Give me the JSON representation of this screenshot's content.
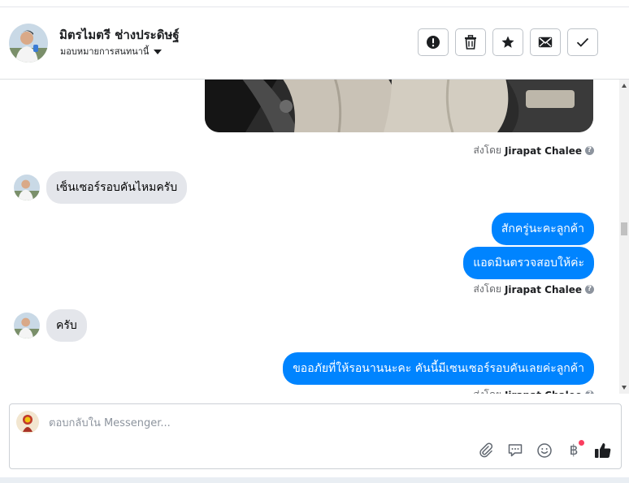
{
  "header": {
    "name": "มิตรไมตรี ช่างประดิษฐ์",
    "assign_label": "มอบหมายการสนทนานี้",
    "actions": [
      {
        "name": "report-button",
        "icon": "exclamation-icon"
      },
      {
        "name": "delete-button",
        "icon": "trash-icon"
      },
      {
        "name": "star-button",
        "icon": "star-icon"
      },
      {
        "name": "mark-unread-button",
        "icon": "envelope-icon"
      },
      {
        "name": "mark-done-button",
        "icon": "checkmark-icon"
      }
    ]
  },
  "conversation": {
    "sent_by_prefix": "ส่งโดย",
    "agent": "Jirapat Chalee",
    "messages": {
      "in_1": "เซ็นเซอร์รอบคันไหมครับ",
      "out_1": "สักครู่นะคะลูกค้า",
      "out_2": "แอดมินตรวจสอบให้ค่ะ",
      "in_2": "ครับ",
      "out_3": "ขออภัยที่ให้รอนานนะคะ คันนี้มีเซนเซอร์รอบคันเลยค่ะลูกค้า"
    }
  },
  "composer": {
    "placeholder": "ตอบกลับใน Messenger..."
  },
  "colors": {
    "accent": "#0084ff",
    "incoming_bubble": "#e4e6eb",
    "notification_dot": "#fa3e5f"
  }
}
